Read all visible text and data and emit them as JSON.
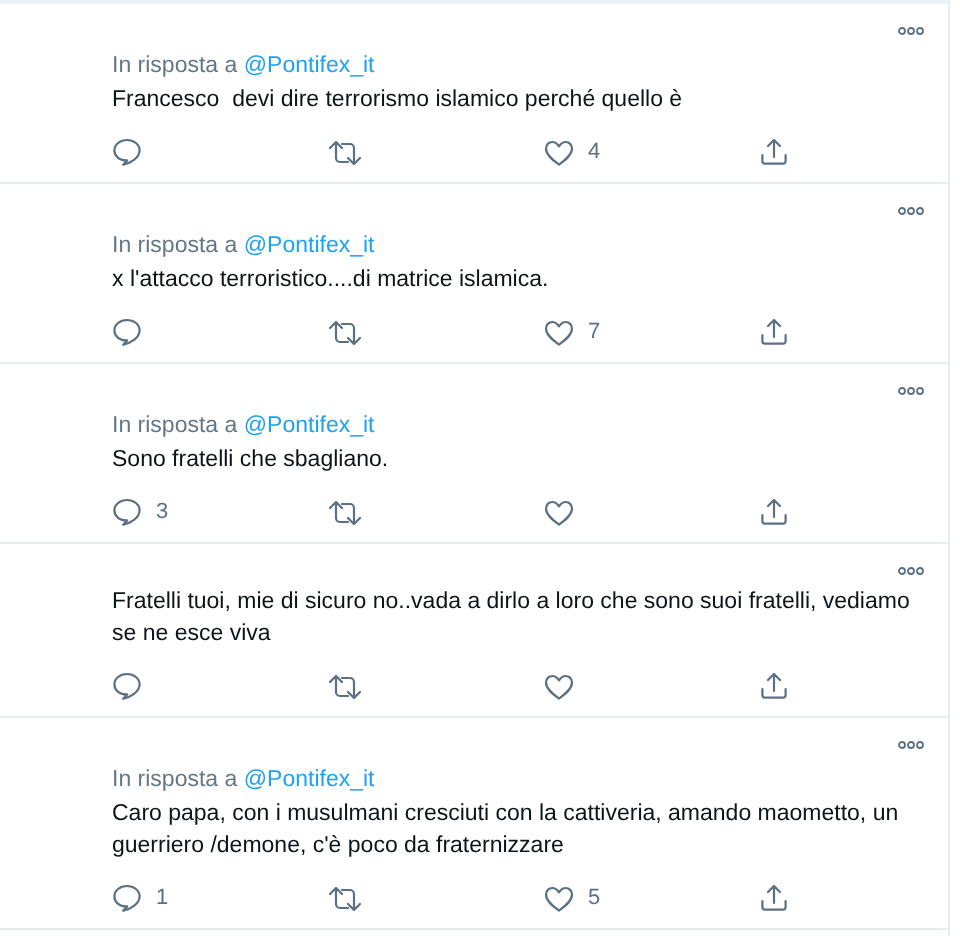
{
  "tweets": [
    {
      "reply_to": {
        "prefix": "In risposta a",
        "handle": "@Pontifex_it"
      },
      "text": "Francesco  devi dire terrorismo islamico perché quello è",
      "actions": [
        {
          "kind": "reply"
        },
        {
          "kind": "retweet"
        },
        {
          "kind": "like",
          "count": "4"
        },
        {
          "kind": "share"
        }
      ]
    },
    {
      "reply_to": {
        "prefix": "In risposta a",
        "handle": "@Pontifex_it"
      },
      "text": "x l'attacco terroristico....di matrice islamica.",
      "actions": [
        {
          "kind": "reply"
        },
        {
          "kind": "retweet"
        },
        {
          "kind": "like",
          "count": "7"
        },
        {
          "kind": "share"
        }
      ]
    },
    {
      "reply_to": {
        "prefix": "In risposta a",
        "handle": "@Pontifex_it"
      },
      "text": "Sono fratelli che sbagliano.",
      "actions": [
        {
          "kind": "reply",
          "count": "3"
        },
        {
          "kind": "retweet"
        },
        {
          "kind": "like"
        },
        {
          "kind": "share"
        }
      ]
    },
    {
      "text": "Fratelli tuoi, mie di sicuro no..vada a dirlo a loro che sono suoi fratelli, vediamo se ne esce viva",
      "actions": [
        {
          "kind": "reply"
        },
        {
          "kind": "retweet"
        },
        {
          "kind": "like"
        },
        {
          "kind": "share"
        }
      ]
    },
    {
      "reply_to": {
        "prefix": "In risposta a",
        "handle": "@Pontifex_it"
      },
      "text": "Caro papa, con i musulmani cresciuti con la cattiveria, amando maometto, un guerriero /demone, c'è poco da fraternizzare",
      "actions": [
        {
          "kind": "reply",
          "count": "1"
        },
        {
          "kind": "retweet"
        },
        {
          "kind": "like",
          "count": "5"
        },
        {
          "kind": "share"
        }
      ]
    }
  ]
}
